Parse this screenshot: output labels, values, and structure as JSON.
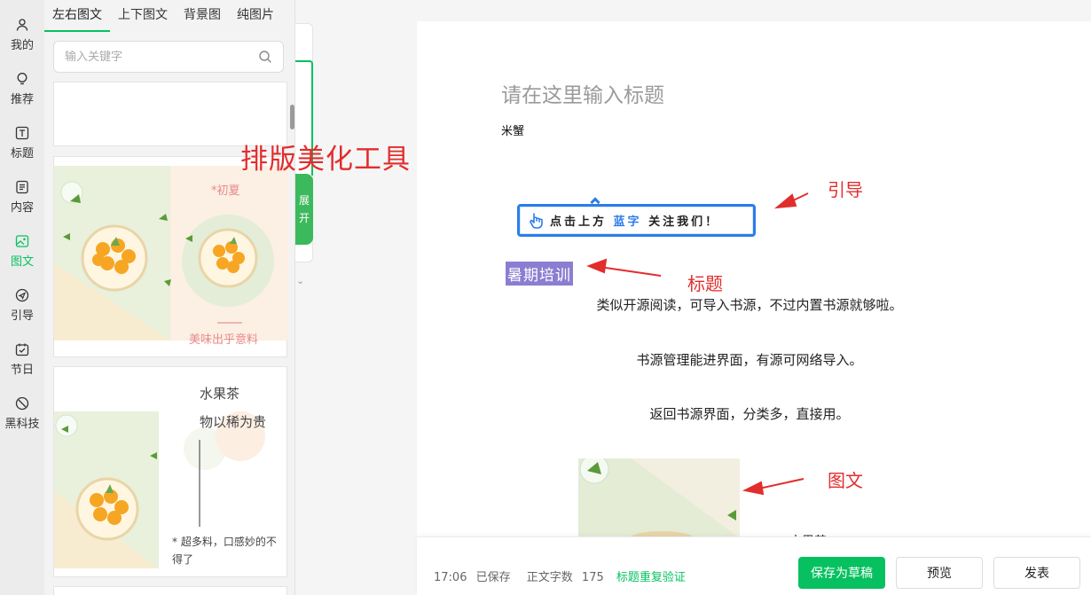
{
  "sidebar": {
    "items": [
      {
        "label": "我的",
        "icon": "user-icon"
      },
      {
        "label": "推荐",
        "icon": "bulb-icon"
      },
      {
        "label": "标题",
        "icon": "title-icon"
      },
      {
        "label": "内容",
        "icon": "document-icon"
      },
      {
        "label": "图文",
        "icon": "image-icon"
      },
      {
        "label": "引导",
        "icon": "send-icon"
      },
      {
        "label": "节日",
        "icon": "calendar-icon"
      },
      {
        "label": "黑科技",
        "icon": "compass-icon"
      }
    ],
    "active_index": 4
  },
  "panel": {
    "tabs": [
      "左右图文",
      "上下图文",
      "背景图",
      "纯图片"
    ],
    "active_tab": 0,
    "search_placeholder": "输入关键字",
    "cards": [
      {
        "top_text": "*初夏",
        "bottom_text": "美味出乎意料"
      },
      {
        "line1": "水果茶",
        "line2": "物以稀为贵",
        "note": "* 超多料，口感妙的不得了"
      }
    ]
  },
  "expand": {
    "label1": "展",
    "label2": "开"
  },
  "overlay_title": "排版美化工具",
  "editor": {
    "title_placeholder": "请在这里输入标题",
    "author": "米蟹",
    "guide_prefix": "点击上方 ",
    "guide_blue": "蓝字",
    "guide_suffix": " 关注我们！",
    "section_title": "暑期培训",
    "paragraphs": [
      "类似开源阅读，可导入书源，不过内置书源就够啦。",
      "书源管理能进界面，有源可网络导入。",
      "返回书源界面，分类多，直接用。"
    ],
    "cut_text": "水果茶"
  },
  "annotations": {
    "guide": "引导",
    "title": "标题",
    "image": "图文"
  },
  "bottom": {
    "time": "17:06",
    "saved": "已保存",
    "word_count_label": "正文字数",
    "word_count": "175",
    "check_link": "标题重复验证",
    "save_draft": "保存为草稿",
    "preview": "预览",
    "publish": "发表"
  },
  "colors": {
    "accent": "#07c160",
    "annotation": "#e22d2d",
    "guide_blue": "#2b7de9",
    "title_bg": "#8b7ed1"
  }
}
